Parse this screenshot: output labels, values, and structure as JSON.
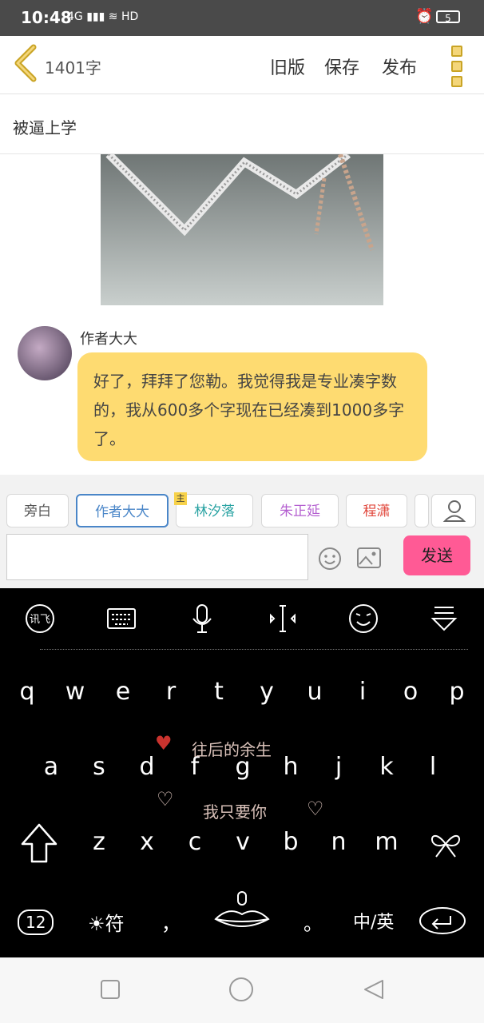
{
  "status": {
    "time": "10:48",
    "signal": "4G",
    "battery": "5"
  },
  "topbar": {
    "word_count": "1401字",
    "old_version": "旧版",
    "save": "保存",
    "publish": "发布"
  },
  "title": "被逼上学",
  "message": {
    "author": "作者大大",
    "text": "好了，拜拜了您勒。我觉得我是专业凑字数的，我从600多个字现在已经凑到1000多字了。"
  },
  "characters": {
    "tabs": [
      "旁白",
      "作者大大",
      "林汐落",
      "朱正延",
      "程潇"
    ],
    "main_tag": "主",
    "selected": "作者大大"
  },
  "composer": {
    "send": "发送"
  },
  "keyboard": {
    "row1": [
      "q",
      "w",
      "e",
      "r",
      "t",
      "y",
      "u",
      "i",
      "o",
      "p"
    ],
    "row2": [
      "a",
      "s",
      "d",
      "f",
      "g",
      "h",
      "j",
      "k",
      "l"
    ],
    "row3": [
      "z",
      "x",
      "c",
      "v",
      "b",
      "n",
      "m"
    ],
    "deco_line1": "往后的余生",
    "deco_line2": "我只要你",
    "bottom": {
      "numbers": "12",
      "symbols": "符",
      "comma": "，",
      "period": "。",
      "lang": "中/英"
    }
  },
  "colors": {
    "bubble": "#fedb71",
    "send": "#ff5a95",
    "selected": "#4a86c8"
  }
}
